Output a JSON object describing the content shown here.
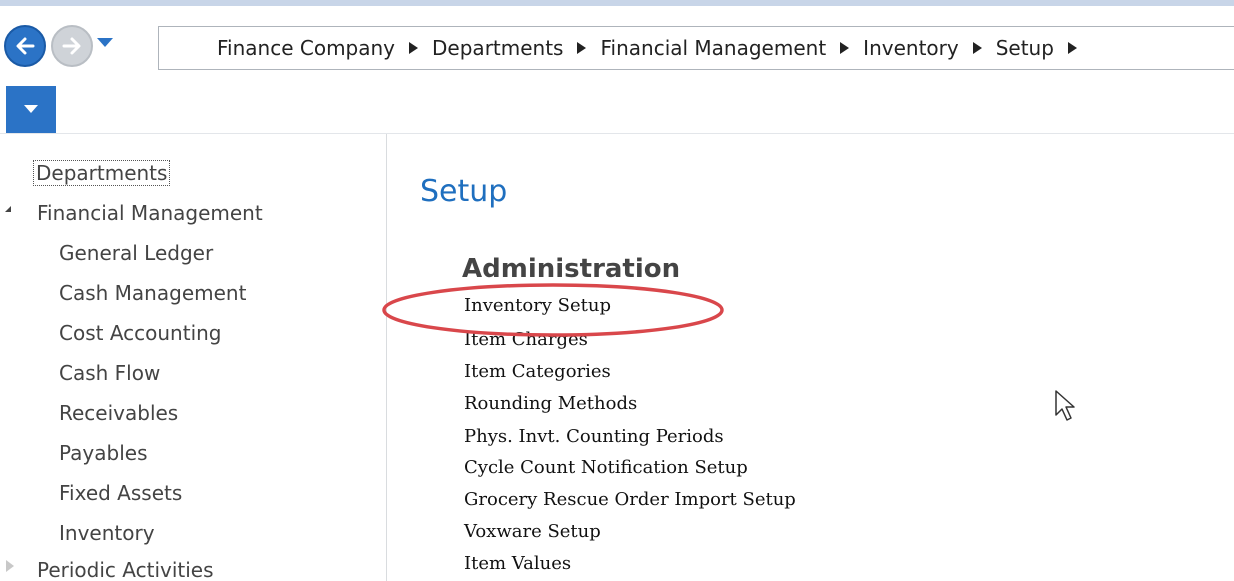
{
  "navigation": {
    "back_icon": "arrow-left-icon",
    "forward_icon": "arrow-right-icon",
    "accent_color": "#2b73c6"
  },
  "address_bar": {
    "breadcrumbs": [
      "Finance Company",
      "Departments",
      "Financial Management",
      "Inventory",
      "Setup"
    ]
  },
  "sidebar": {
    "root": "Departments",
    "expanded_group": "Financial Management",
    "items": [
      "General Ledger",
      "Cash Management",
      "Cost Accounting",
      "Cash Flow",
      "Receivables",
      "Payables",
      "Fixed Assets",
      "Inventory"
    ],
    "collapsed_group": "Periodic Activities"
  },
  "main": {
    "page_title": "Setup",
    "section_heading": "Administration",
    "links": [
      "Inventory Setup",
      "Item Charges",
      "Item Categories",
      "Rounding Methods",
      "Phys. Invt. Counting Periods",
      "Cycle Count Notification Setup",
      "Grocery Rescue Order Import Setup",
      "Voxware Setup",
      "Item Values"
    ],
    "highlighted_link": "Inventory Setup",
    "highlight_color": "#d9474b"
  }
}
